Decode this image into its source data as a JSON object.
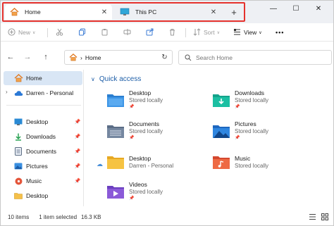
{
  "tabs": [
    {
      "label": "Home",
      "icon": "home-icon"
    },
    {
      "label": "This PC",
      "icon": "monitor-icon"
    }
  ],
  "tab_close_glyph": "✕",
  "new_tab_glyph": "+",
  "window_controls": {
    "minimize": "—",
    "maximize": "☐",
    "close": "✕"
  },
  "toolbar": {
    "new_label": "New",
    "sort_label": "Sort",
    "view_label": "View",
    "more_label": "•••"
  },
  "nav": {
    "back": "←",
    "forward": "→",
    "up": "↑",
    "refresh": "↻"
  },
  "address": {
    "crumb": "Home",
    "separator": "›"
  },
  "search": {
    "placeholder": "Search Home"
  },
  "sidebar": {
    "items": [
      {
        "label": "Home",
        "icon": "home-icon"
      },
      {
        "label": "Darren - Personal",
        "icon": "cloud-icon",
        "expand": "›"
      },
      {
        "label": "Desktop",
        "icon": "desktop-folder-icon",
        "pin": "📌"
      },
      {
        "label": "Downloads",
        "icon": "download-icon",
        "pin": "📌"
      },
      {
        "label": "Documents",
        "icon": "documents-icon",
        "pin": "📌"
      },
      {
        "label": "Pictures",
        "icon": "pictures-icon",
        "pin": "📌"
      },
      {
        "label": "Music",
        "icon": "music-icon",
        "pin": "📌"
      },
      {
        "label": "Desktop",
        "icon": "folder-icon",
        "pin": ""
      }
    ]
  },
  "quick_access": {
    "title": "Quick access",
    "chevron": "∨",
    "items": [
      {
        "name": "Desktop",
        "sub": "Stored locally",
        "pin": "📌",
        "icon": "desktop-folder-icon"
      },
      {
        "name": "Downloads",
        "sub": "Stored locally",
        "pin": "📌",
        "icon": "downloads-folder-icon"
      },
      {
        "name": "Documents",
        "sub": "Stored locally",
        "pin": "📌",
        "icon": "documents-folder-icon"
      },
      {
        "name": "Pictures",
        "sub": "Stored locally",
        "pin": "📌",
        "icon": "pictures-folder-icon"
      },
      {
        "name": "Desktop",
        "sub": "Darren - Personal",
        "pin": "",
        "icon": "folder-icon"
      },
      {
        "name": "Music",
        "sub": "Stored locally",
        "pin": "",
        "icon": "music-folder-icon"
      },
      {
        "name": "Videos",
        "sub": "Stored locally",
        "pin": "📌",
        "icon": "videos-folder-icon"
      }
    ]
  },
  "cloud_marker": "☁",
  "status": {
    "items": "10 items",
    "selected": "1 item selected",
    "size": "16.3 KB"
  },
  "colors": {
    "accent": "#1f5fa8",
    "tab_highlight": "#e5322d",
    "selected_bg": "#d9e6f5"
  }
}
